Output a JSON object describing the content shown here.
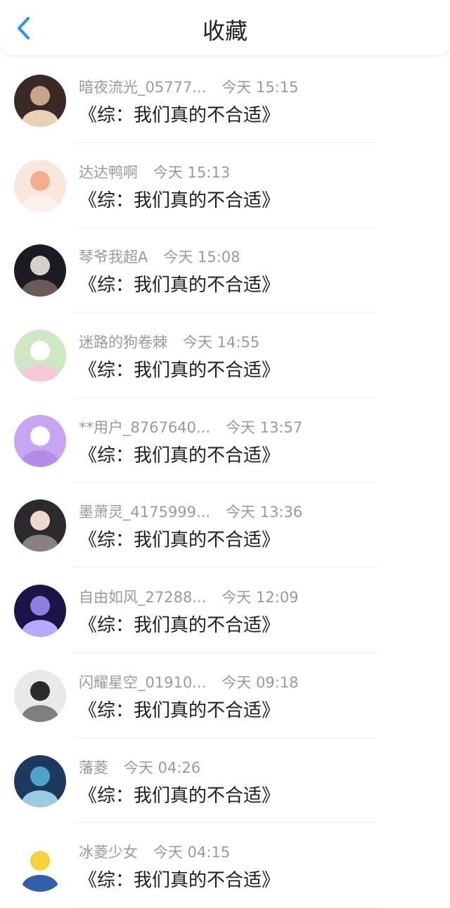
{
  "header": {
    "title": "收藏",
    "back_icon": "chevron-left-icon",
    "accent": "#2196f3"
  },
  "items": [
    {
      "user": "暗夜流光_05777...",
      "time": "今天 15:15",
      "book": "《综：我们真的不合适》",
      "avatar": {
        "bg": "#3a2a25",
        "fg": "#c9a58a",
        "ring": "#e8d3b8"
      }
    },
    {
      "user": "达达鸭啊",
      "time": "今天 15:13",
      "book": "《综：我们真的不合适》",
      "avatar": {
        "bg": "#f8e6df",
        "fg": "#f1b089",
        "ring": "#fbf1ec"
      }
    },
    {
      "user": "琴爷我超A",
      "time": "今天 15:08",
      "book": "《综：我们真的不合适》",
      "avatar": {
        "bg": "#1b1b24",
        "fg": "#d8d0c6",
        "ring": "#6a5a58"
      }
    },
    {
      "user": "迷路的狗卷棘",
      "time": "今天 14:55",
      "book": "《综：我们真的不合适》",
      "avatar": {
        "bg": "#cfe8c4",
        "fg": "#ffffff",
        "ring": "#f6c7d6"
      }
    },
    {
      "user": "**用户_8767640...",
      "time": "今天 13:57",
      "book": "《综：我们真的不合适》",
      "avatar": {
        "bg": "#c6a6f2",
        "fg": "#ffffff",
        "ring": "#b48de8"
      }
    },
    {
      "user": "墨萧灵_4175999...",
      "time": "今天 13:36",
      "book": "《综：我们真的不合适》",
      "avatar": {
        "bg": "#2b2a2e",
        "fg": "#efd8d0",
        "ring": "#8a7f82"
      }
    },
    {
      "user": "自由如风_27288...",
      "time": "今天 12:09",
      "book": "《综：我们真的不合适》",
      "avatar": {
        "bg": "#1a1546",
        "fg": "#8e7ee0",
        "ring": "#b7a9ff"
      }
    },
    {
      "user": "闪耀星空_01910...",
      "time": "今天 09:18",
      "book": "《综：我们真的不合适》",
      "avatar": {
        "bg": "#e9e9e9",
        "fg": "#2b2b2b",
        "ring": "#7f7f7f"
      }
    },
    {
      "user": "藩菱",
      "time": "今天 04:26",
      "book": "《综：我们真的不合适》",
      "avatar": {
        "bg": "#1d3a5e",
        "fg": "#4ea3c9",
        "ring": "#9acbe0"
      }
    },
    {
      "user": "冰菱少女",
      "time": "今天 04:15",
      "book": "《综：我们真的不合适》",
      "avatar": {
        "bg": "#ffffff",
        "fg": "#f3d23c",
        "ring": "#2f5fa8"
      }
    }
  ]
}
